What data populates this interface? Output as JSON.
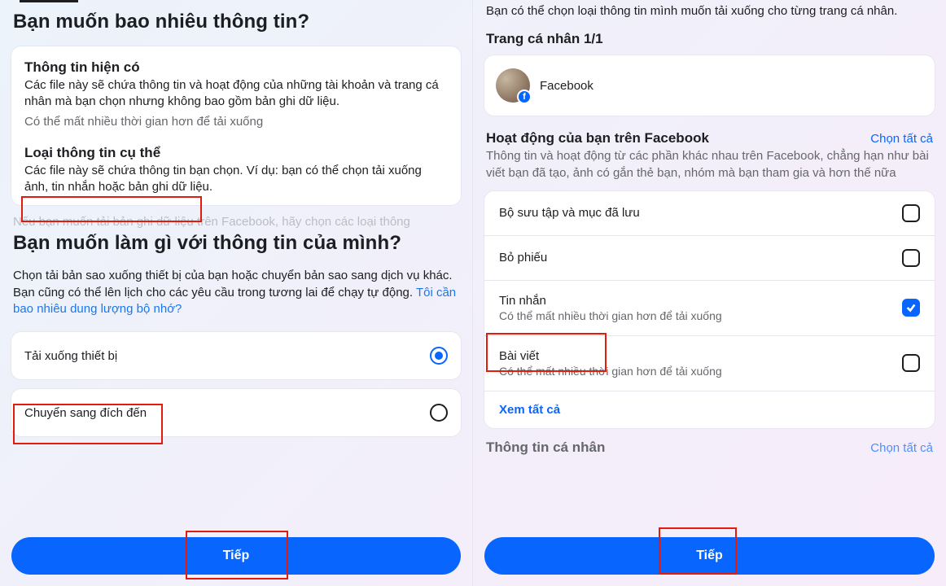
{
  "left": {
    "heading": "Bạn muốn bao nhiêu thông tin?",
    "opt1": {
      "title": "Thông tin hiện có",
      "desc": "Các file này sẽ chứa thông tin và hoạt động của những tài khoản và trang cá nhân mà bạn chọn nhưng không bao gồm bản ghi dữ liệu.",
      "note": "Có thể mất nhiều thời gian hơn để tải xuống"
    },
    "opt2": {
      "title": "Loại thông tin cụ thể",
      "desc": "Các file này sẽ chứa thông tin bạn chọn. Ví dụ: bạn có thể chọn tải xuống ảnh, tin nhắn hoặc bản ghi dữ liệu."
    },
    "ghost": "Nếu bạn muốn tải bản ghi dữ liệu trên Facebook, hãy chọn các loại thông",
    "heading2": "Bạn muốn làm gì với thông tin của mình?",
    "desc2a": "Chọn tải bản sao xuống thiết bị của bạn hoặc chuyển bản sao sang dịch vụ khác. Bạn cũng có thể lên lịch cho các yêu cầu trong tương lai để chạy tự động. ",
    "desc2link": "Tôi cần bao nhiêu dung lượng bộ nhớ?",
    "radio1": "Tải xuống thiết bị",
    "radio2": "Chuyển sang đích đến",
    "next": "Tiếp"
  },
  "right": {
    "intro": "Bạn có thể chọn loại thông tin mình muốn tải xuống cho từng trang cá nhân.",
    "profile_heading": "Trang cá nhân 1/1",
    "profile_name": "Facebook",
    "section_title": "Hoạt động của bạn trên Facebook",
    "select_all": "Chọn tất cả",
    "section_desc": "Thông tin và hoạt động từ các phần khác nhau trên Facebook, chẳng hạn như bài viết bạn đã tạo, ảnh có gắn thẻ bạn, nhóm mà bạn tham gia và hơn thế nữa",
    "items": [
      {
        "title": "Bộ sưu tập và mục đã lưu",
        "sub": "",
        "checked": false
      },
      {
        "title": "Bỏ phiếu",
        "sub": "",
        "checked": false
      },
      {
        "title": "Tin nhắn",
        "sub": "Có thể mất nhiều thời gian hơn để tải xuống",
        "checked": true
      },
      {
        "title": "Bài viết",
        "sub": "Có thể mất nhiều thời gian hơn để tải xuống",
        "checked": false
      }
    ],
    "view_all": "Xem tất cả",
    "section2_title": "Thông tin cá nhân",
    "section2_select_all": "Chọn tất cả",
    "next": "Tiếp"
  }
}
